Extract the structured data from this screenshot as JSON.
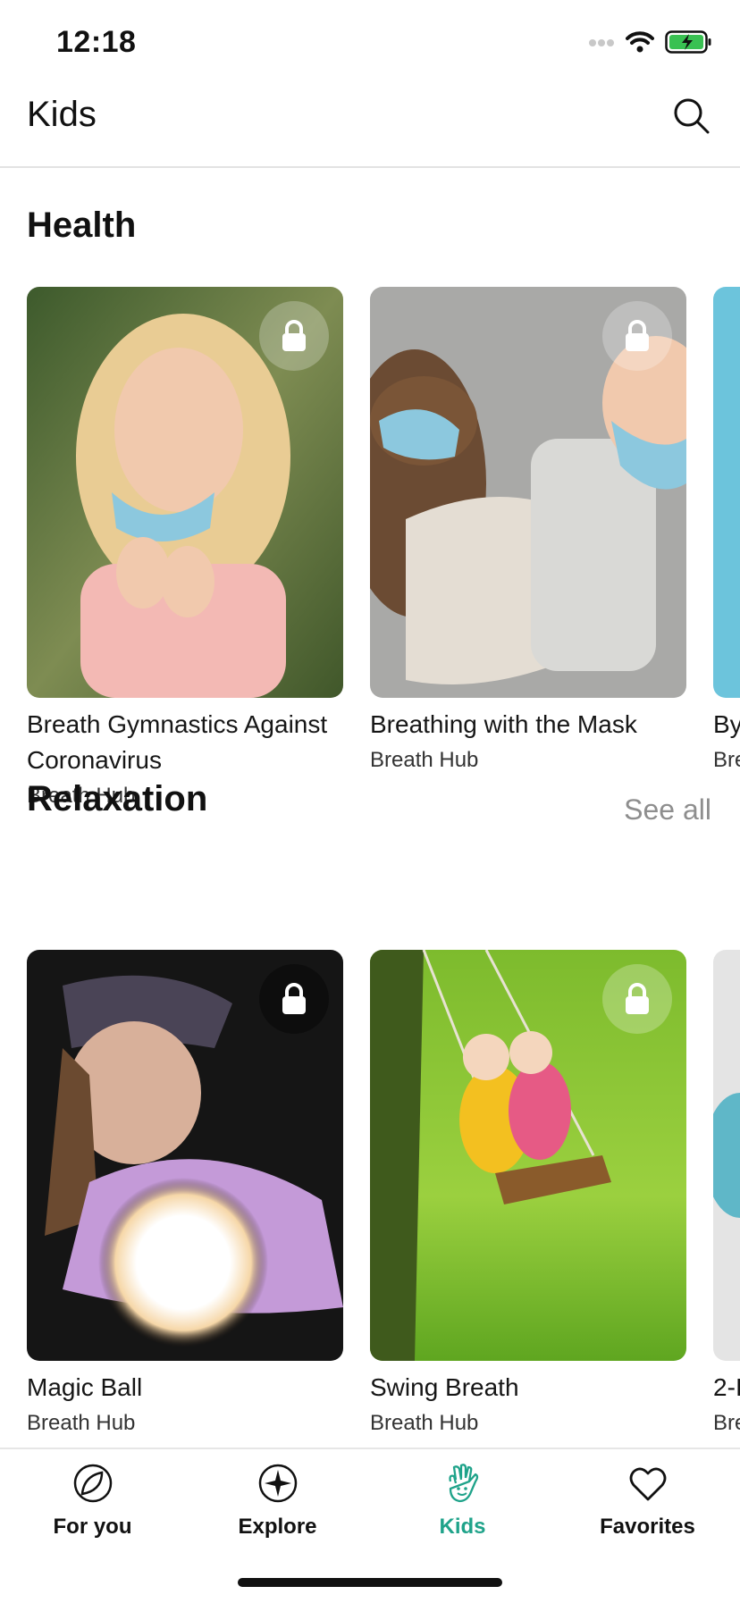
{
  "status": {
    "time": "12:18"
  },
  "header": {
    "title": "Kids"
  },
  "sections": [
    {
      "title": "Health",
      "see_all": "",
      "cards": [
        {
          "title": "Breath Gymnastics Against Coronavirus",
          "subtitle": "Breath Hub",
          "locked": true
        },
        {
          "title": "Breathing with the Mask",
          "subtitle": "Breath Hub",
          "locked": true
        },
        {
          "title": "By",
          "subtitle": "Bre",
          "locked": false
        }
      ]
    },
    {
      "title": "Relaxation",
      "see_all": "See all",
      "cards": [
        {
          "title": "Magic Ball",
          "subtitle": "Breath Hub",
          "locked": true
        },
        {
          "title": "Swing Breath",
          "subtitle": "Breath Hub",
          "locked": true
        },
        {
          "title": "2-I",
          "subtitle": "Bre",
          "locked": false
        }
      ]
    }
  ],
  "tabs": [
    {
      "label": "For you",
      "icon": "leaf-icon",
      "active": false
    },
    {
      "label": "Explore",
      "icon": "compass-star-icon",
      "active": false
    },
    {
      "label": "Kids",
      "icon": "hand-smile-icon",
      "active": true
    },
    {
      "label": "Favorites",
      "icon": "heart-icon",
      "active": false
    }
  ],
  "colors": {
    "accent": "#1fa38a",
    "muted": "#8e8e8e"
  }
}
